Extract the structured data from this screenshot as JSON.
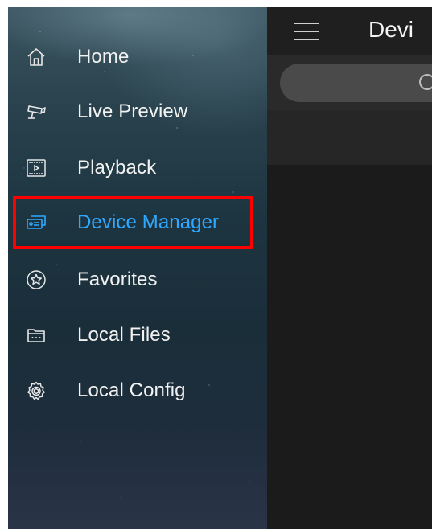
{
  "header": {
    "title": "Devi"
  },
  "search": {
    "placeholder": ""
  },
  "sidebar": {
    "active_color": "#2fa8ff",
    "highlight_color": "#ff0000",
    "items": [
      {
        "label": "Home",
        "icon": "home-icon"
      },
      {
        "label": "Live Preview",
        "icon": "camera-icon"
      },
      {
        "label": "Playback",
        "icon": "playback-icon"
      },
      {
        "label": "Device Manager",
        "icon": "device-icon",
        "active": true
      },
      {
        "label": "Favorites",
        "icon": "star-icon"
      },
      {
        "label": "Local Files",
        "icon": "folder-icon"
      },
      {
        "label": "Local Config",
        "icon": "gear-icon"
      }
    ]
  }
}
